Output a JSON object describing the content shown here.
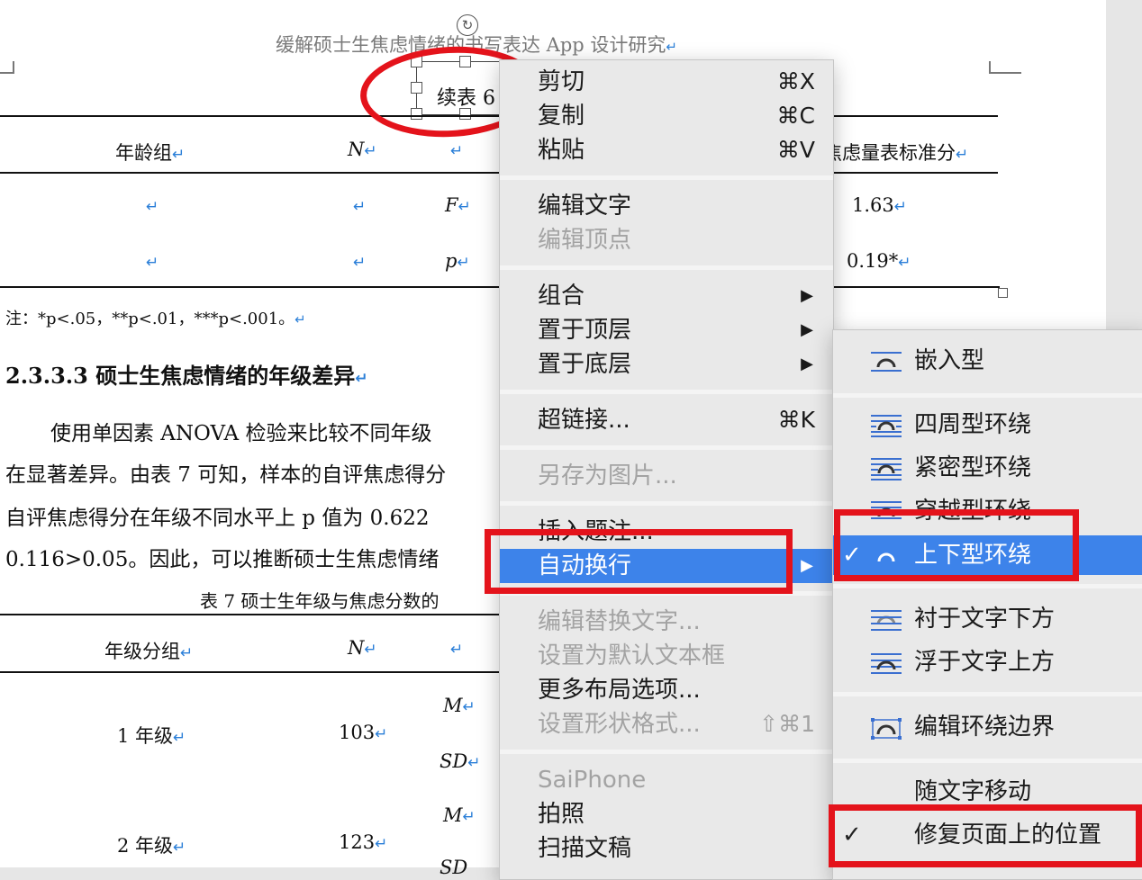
{
  "doc": {
    "header": "缓解硕士生焦虑情绪的书写表达 App 设计研究",
    "caption_cont": "续表 6",
    "table6": {
      "headers": [
        "年龄组",
        "N",
        "",
        "焦虑量表标准分"
      ],
      "rows": [
        {
          "stat": "F",
          "value": "1.63"
        },
        {
          "stat": "p",
          "value": "0.19*"
        }
      ]
    },
    "note": "注：*p<.05，**p<.01，***p<.001。",
    "section_title": "2.3.3.3 硕士生焦虑情绪的年级差异",
    "paragraph_lines": [
      "使用单因素 ANOVA 检验来比较不同年级",
      "在显著差异。由表 7 可知，样本的自评焦虑得分",
      "自评焦虑得分在年级不同水平上 p 值为 0.622",
      "0.116>0.05。因此，可以推断硕士生焦虑情绪"
    ],
    "table7_caption": "表 7  硕士生年级与焦虑分数的",
    "table7": {
      "headers": [
        "年级分组",
        "N",
        ""
      ],
      "rows": [
        {
          "group": "1 年级",
          "n": "103",
          "stats": [
            "M",
            "SD"
          ]
        },
        {
          "group": "2 年级",
          "n": "123",
          "stats": [
            "M",
            "SD"
          ]
        }
      ]
    }
  },
  "context_menu": {
    "items": [
      {
        "label": "剪切",
        "shortcut": "⌘X",
        "enabled": true
      },
      {
        "label": "复制",
        "shortcut": "⌘C",
        "enabled": true
      },
      {
        "label": "粘贴",
        "shortcut": "⌘V",
        "enabled": true
      },
      {
        "label": "编辑文字",
        "enabled": true
      },
      {
        "label": "编辑顶点",
        "enabled": false
      },
      {
        "label": "组合",
        "submenu": true,
        "enabled": true
      },
      {
        "label": "置于顶层",
        "submenu": true,
        "enabled": true
      },
      {
        "label": "置于底层",
        "submenu": true,
        "enabled": true
      },
      {
        "label": "超链接...",
        "shortcut": "⌘K",
        "enabled": true
      },
      {
        "label": "另存为图片...",
        "enabled": false
      },
      {
        "label": "插入题注...",
        "enabled": true
      },
      {
        "label": "自动换行",
        "submenu": true,
        "enabled": true,
        "highlighted": true
      },
      {
        "label": "编辑替换文字...",
        "enabled": false
      },
      {
        "label": "设置为默认文本框",
        "enabled": false
      },
      {
        "label": "更多布局选项...",
        "enabled": true
      },
      {
        "label": "设置形状格式...",
        "shortcut": "⇧⌘1",
        "enabled": false
      },
      {
        "label": "SaiPhone",
        "enabled": false
      },
      {
        "label": "拍照",
        "enabled": true
      },
      {
        "label": "扫描文稿",
        "enabled": true
      }
    ],
    "arrow": "▶"
  },
  "wrap_submenu": {
    "items": [
      {
        "label": "嵌入型",
        "icon": "inline-wrap-icon"
      },
      {
        "label": "四周型环绕",
        "icon": "square-wrap-icon"
      },
      {
        "label": "紧密型环绕",
        "icon": "tight-wrap-icon"
      },
      {
        "label": "穿越型环绕",
        "icon": "through-wrap-icon"
      },
      {
        "label": "上下型环绕",
        "icon": "top-bottom-wrap-icon",
        "checked": true,
        "highlighted": true
      },
      {
        "label": "衬于文字下方",
        "icon": "behind-text-icon"
      },
      {
        "label": "浮于文字上方",
        "icon": "in-front-text-icon"
      },
      {
        "label": "编辑环绕边界",
        "icon": "edit-wrap-points-icon"
      },
      {
        "label": "随文字移动"
      },
      {
        "label": "修复页面上的位置",
        "checked": true
      }
    ],
    "checkmark": "✓"
  },
  "colors": {
    "highlight": "#3d83ea",
    "annotation_red": "#e4131b",
    "return_mark": "#2b7fd8"
  }
}
